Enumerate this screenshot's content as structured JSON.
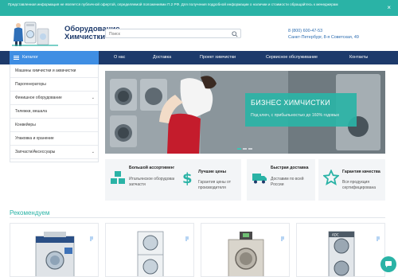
{
  "notice": {
    "text": "Представленная информация не является публичной офертой, определяемой положениями П.2 РФ. Для получения подробной информации о наличии и стоимости обращайтесь к менеджерам",
    "close": "×"
  },
  "header": {
    "logo_line1": "Оборудование",
    "logo_line2": "Химчистки",
    "search_placeholder": "Поиск",
    "phone": "8 (800) 600-47-53",
    "address": "Санкт-Петербург, 8-я Советская, 49"
  },
  "nav": {
    "catalog": "Каталог",
    "links": [
      "О нас",
      "Доставка",
      "Проект химчистки",
      "Сервисное обслуживание",
      "Контакты"
    ]
  },
  "sidebar": {
    "items": [
      {
        "label": "Машины химчистки и аквачистки",
        "chevron": ""
      },
      {
        "label": "Парогенераторы",
        "chevron": ""
      },
      {
        "label": "Финишное оборудование",
        "chevron": "⌄"
      },
      {
        "label": "Тележки, вешала",
        "chevron": ""
      },
      {
        "label": "Конвейеры",
        "chevron": ""
      },
      {
        "label": "Упаковка и хранение",
        "chevron": ""
      },
      {
        "label": "Запчасти/Аксессуары",
        "chevron": "⌄"
      }
    ]
  },
  "banner": {
    "title": "БИЗНЕС ХИМЧИСТКИ",
    "subtitle": "Под ключ, с прибыльностью до 160% годовых",
    "slides": 3,
    "active_slide": 1
  },
  "features": [
    {
      "title": "Большой ассортимент",
      "desc": "Итальянское оборудование и запчасти",
      "icon": "boxes-icon"
    },
    {
      "title": "Лучшие цены",
      "desc": "Гарантия цены от производителя",
      "icon": "dollar-icon"
    },
    {
      "title": "Быстрая доставка",
      "desc": "Доставим по всей России",
      "icon": "truck-icon"
    },
    {
      "title": "Гарантия качества",
      "desc": "Вся продукция сертифицирована",
      "icon": "star-icon"
    }
  ],
  "recommended": {
    "title": "Рекомендуем",
    "products": [
      {
        "name": "dry-cleaning-machine"
      },
      {
        "name": "stacked-dryer"
      },
      {
        "name": "washer-extractor"
      },
      {
        "name": "stacked-dryer-adc"
      }
    ]
  },
  "colors": {
    "accent": "#2ab3a6",
    "navy": "#1d3a6b",
    "catalog": "#3f8ee3",
    "link": "#2b6cb0"
  }
}
